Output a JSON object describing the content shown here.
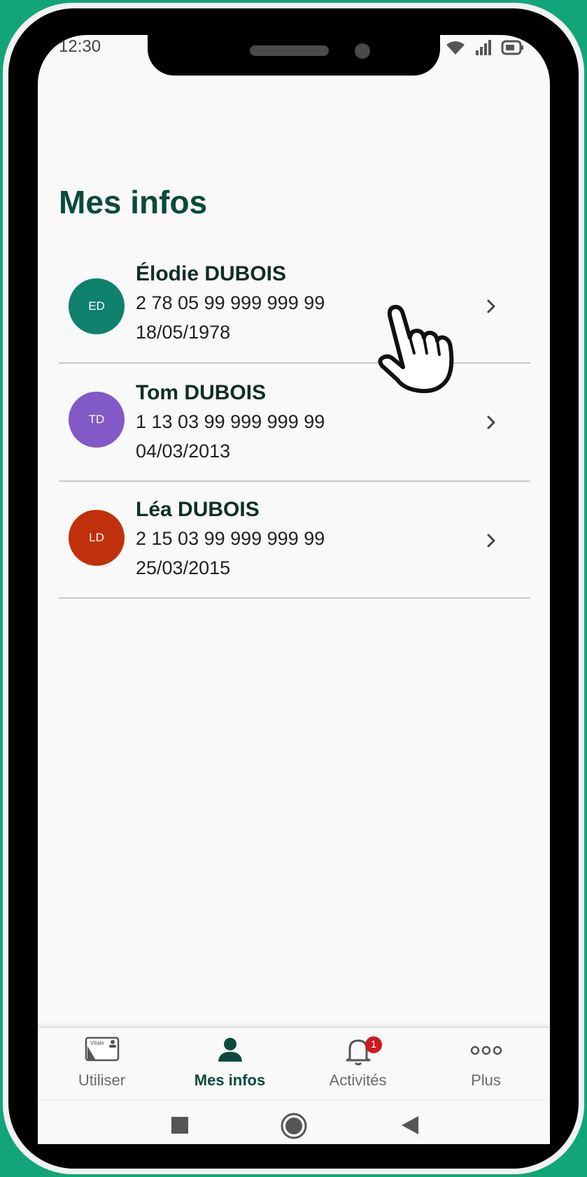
{
  "status_bar": {
    "time": "12:30"
  },
  "page": {
    "title": "Mes infos"
  },
  "profiles": [
    {
      "initials": "ED",
      "name": "Élodie DUBOIS",
      "number": "2 78 05 99 999 999 99",
      "birthdate": "18/05/1978",
      "color": "#10806f"
    },
    {
      "initials": "TD",
      "name": "Tom DUBOIS",
      "number": "1 13 03 99 999 999 99",
      "birthdate": "04/03/2013",
      "color": "#8259c6"
    },
    {
      "initials": "LD",
      "name": "Léa DUBOIS",
      "number": "2 15 03 99 999 999 99",
      "birthdate": "25/03/2015",
      "color": "#c0310b"
    }
  ],
  "tabs": [
    {
      "label": "Utiliser",
      "icon": "vitale-card-icon",
      "card_text": "Vitale"
    },
    {
      "label": "Mes infos",
      "icon": "person-icon",
      "active": true
    },
    {
      "label": "Activités",
      "icon": "bell-icon",
      "badge": "1"
    },
    {
      "label": "Plus",
      "icon": "more-dots-icon"
    }
  ],
  "colors": {
    "brand_green": "#0b4a3c",
    "background_green": "#12a57a",
    "badge_red": "#d0191d"
  }
}
